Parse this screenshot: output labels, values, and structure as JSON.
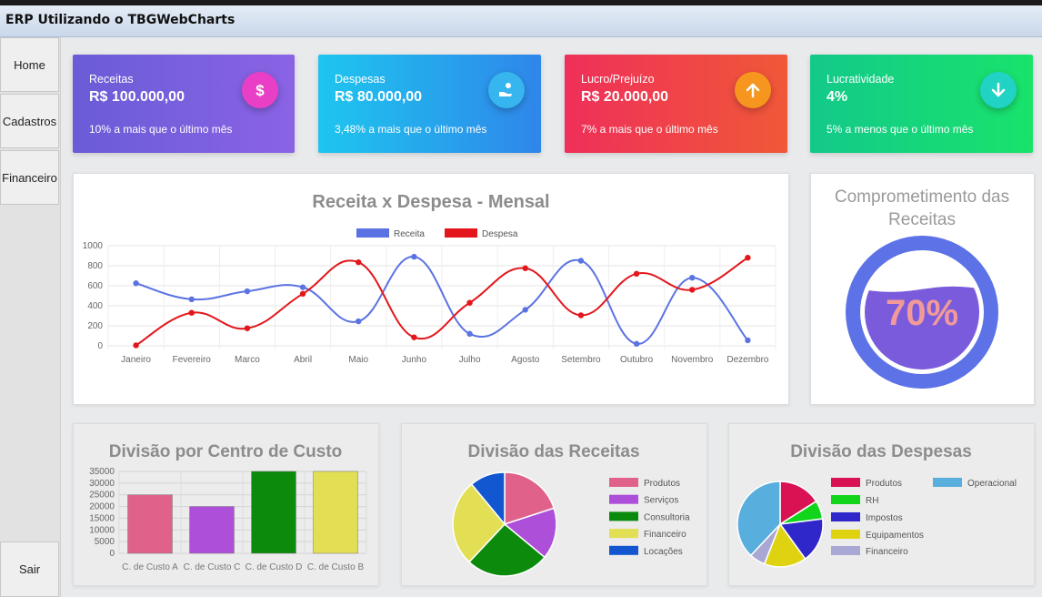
{
  "window": {
    "title": "ERP Utilizando o TBGWebCharts"
  },
  "sidebar": {
    "items": [
      {
        "label": "Home"
      },
      {
        "label": "Cadastros"
      },
      {
        "label": "Financeiro"
      }
    ],
    "exit_label": "Sair"
  },
  "cards": [
    {
      "label": "Receitas",
      "value": "R$ 100.000,00",
      "sub": "10% a mais que o último mês",
      "icon": "dollar-icon"
    },
    {
      "label": "Despesas",
      "value": "R$ 80.000,00",
      "sub": "3,48% a mais que o último mês",
      "icon": "hand-coin-icon"
    },
    {
      "label": "Lucro/Prejuízo",
      "value": "R$ 20.000,00",
      "sub": "7% a mais que o último mês",
      "icon": "arrow-up-icon"
    },
    {
      "label": "Lucratividade",
      "value": "4%",
      "sub": "5% a menos que o último mês",
      "icon": "arrow-down-icon"
    }
  ],
  "chart_data": [
    {
      "type": "line",
      "title": "Receita x Despesa - Mensal",
      "categories": [
        "Janeiro",
        "Fevereiro",
        "Marco",
        "Abril",
        "Maio",
        "Junho",
        "Julho",
        "Agosto",
        "Setembro",
        "Outubro",
        "Novembro",
        "Dezembro"
      ],
      "series": [
        {
          "name": "Receita",
          "color": "#5b73e2",
          "values": [
            625,
            465,
            545,
            585,
            245,
            890,
            120,
            360,
            850,
            20,
            680,
            55
          ]
        },
        {
          "name": "Despesa",
          "color": "#e3161c",
          "values": [
            5,
            330,
            175,
            520,
            835,
            85,
            430,
            775,
            305,
            720,
            560,
            880
          ]
        }
      ],
      "ylim": [
        0,
        1000
      ],
      "yticks": [
        "0",
        "200",
        "400",
        "600",
        "800",
        "1000"
      ],
      "legend": "top"
    },
    {
      "type": "gauge",
      "title": "Comprometimento das Receitas",
      "value": 70,
      "label": "70%"
    },
    {
      "type": "bar",
      "title": "Divisão por Centro de Custo",
      "categories": [
        "C. de Custo A",
        "C. de Custo C",
        "C. de Custo D",
        "C. de Custo B"
      ],
      "values": [
        25000,
        20000,
        35000,
        35000
      ],
      "colors": [
        "#e0628a",
        "#ad4fd8",
        "#0c8a0c",
        "#e2df55"
      ],
      "ylim": [
        0,
        35000
      ],
      "yticks": [
        "0",
        "5000",
        "10000",
        "15000",
        "20000",
        "25000",
        "30000",
        "35000"
      ]
    },
    {
      "type": "pie",
      "title": "Divisão das Receitas",
      "labels": [
        "Produtos",
        "Serviços",
        "Consultoria",
        "Financeiro",
        "Locações"
      ],
      "values": [
        20,
        16,
        26,
        27,
        11
      ],
      "colors": [
        "#e0628a",
        "#ad4fd8",
        "#0c8a0c",
        "#e2df55",
        "#1257cf"
      ],
      "legend": "right"
    },
    {
      "type": "pie",
      "title": "Divisão das Despesas",
      "labels": [
        "Produtos",
        "RH",
        "Impostos",
        "Equipamentos",
        "Financeiro",
        "Operacional"
      ],
      "values": [
        16,
        7,
        17,
        16,
        6,
        38
      ],
      "colors": [
        "#d81253",
        "#11d51b",
        "#2f27c9",
        "#dfd311",
        "#a9a7d4",
        "#58aedc"
      ],
      "legend": "right"
    }
  ]
}
